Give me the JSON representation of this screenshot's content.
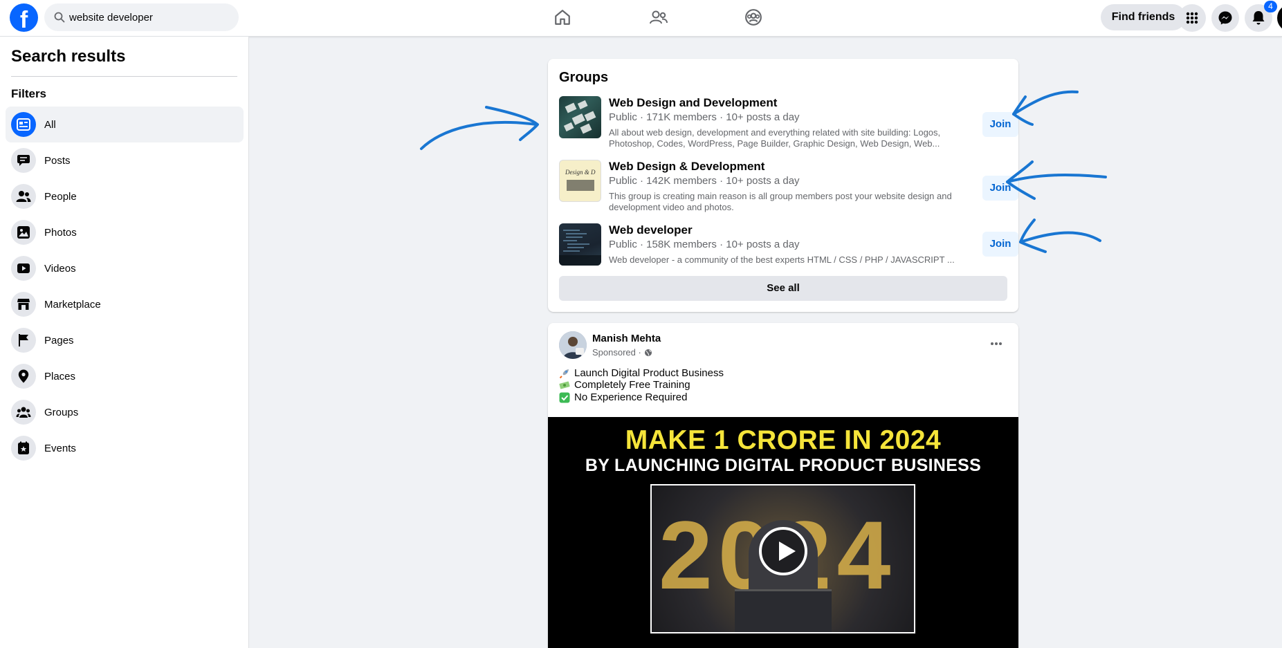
{
  "search": {
    "value": "website developer"
  },
  "header": {
    "find_friends": "Find friends",
    "notification_count": "4"
  },
  "sidebar": {
    "title": "Search results",
    "filters_label": "Filters",
    "items": [
      {
        "label": "All",
        "icon": "feed-icon"
      },
      {
        "label": "Posts",
        "icon": "posts-icon"
      },
      {
        "label": "People",
        "icon": "people-icon"
      },
      {
        "label": "Photos",
        "icon": "photos-icon"
      },
      {
        "label": "Videos",
        "icon": "videos-icon"
      },
      {
        "label": "Marketplace",
        "icon": "marketplace-icon"
      },
      {
        "label": "Pages",
        "icon": "flag-icon"
      },
      {
        "label": "Places",
        "icon": "location-pin-icon"
      },
      {
        "label": "Groups",
        "icon": "groups-icon"
      },
      {
        "label": "Events",
        "icon": "calendar-icon"
      }
    ]
  },
  "groups": {
    "title": "Groups",
    "items": [
      {
        "name": "Web Design and Development",
        "meta": "Public · 171K members · 10+ posts a day",
        "desc": "All about web design, development and everything related with site building: Logos, Photoshop, Codes, WordPress, Page Builder, Graphic Design, Web Design, Web...",
        "join": "Join"
      },
      {
        "name": "Web Design & Development",
        "meta": "Public · 142K members · 10+ posts a day",
        "desc": "This group is creating main reason is all group members post your website design and development video and photos.",
        "join": "Join",
        "thumb_text": "Design & D"
      },
      {
        "name": "Web developer",
        "meta": "Public · 158K members · 10+ posts a day",
        "desc": "Web developer - a community of the best experts HTML / CSS / PHP / JAVASCRIPT ...",
        "join": "Join"
      }
    ],
    "see_all": "See all"
  },
  "post": {
    "author": "Manish Mehta",
    "sponsored": "Sponsored ·",
    "lines": [
      {
        "text": "Launch Digital Product Business",
        "emoji": "rocket-emoji"
      },
      {
        "text": "Completely Free Training",
        "emoji": "money-emoji"
      },
      {
        "text": "No Experience Required",
        "emoji": "check-mark-emoji"
      }
    ],
    "media": {
      "headline": "MAKE 1 CRORE IN 2024",
      "subheadline": "BY LAUNCHING DIGITAL PRODUCT BUSINESS",
      "digits": "2024"
    }
  },
  "colors": {
    "brand": "#0866ff",
    "annotation": "#1976d2",
    "join_bg": "#ebf5ff",
    "join_text": "#0064d1"
  }
}
